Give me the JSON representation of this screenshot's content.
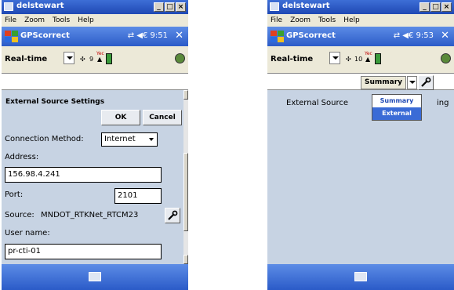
{
  "left": {
    "window_title": "delstewart",
    "menu": [
      "File",
      "Zoom",
      "Tools",
      "Help"
    ],
    "app_title": "GPScorrect",
    "status": "⇄ ◀€ 9:51",
    "close": "✕",
    "mode": "Real-time",
    "sats": "9",
    "hdop": "Yec",
    "section_title": "External Source Settings",
    "ok": "OK",
    "cancel": "Cancel",
    "conn_label": "Connection Method:",
    "conn_value": "Internet",
    "address_label": "Address:",
    "address_value": "156.98.4.241",
    "port_label": "Port:",
    "port_value": "2101",
    "source_label": "Source:",
    "source_value": "MNDOT_RTKNet_RTCM23",
    "username_label": "User name:",
    "username_value": "pr-cti-01"
  },
  "right": {
    "window_title": "delstewart",
    "menu": [
      "File",
      "Zoom",
      "Tools",
      "Help"
    ],
    "app_title": "GPScorrect",
    "status": "⇄ ◀€ 9:53",
    "close": "✕",
    "mode": "Real-time",
    "sats": "10",
    "hdop": "Yec",
    "summary_select": "Summary",
    "dropdown_options": [
      "Summary",
      "External"
    ],
    "selected_option": "External",
    "content_label": "External Source",
    "content_tail": "ing"
  },
  "colors": {
    "titlebar": "#2a55c0",
    "nav": "#3a6bd6",
    "content_bg": "#c7d3e3",
    "toolbar_bg": "#ece9d8"
  }
}
